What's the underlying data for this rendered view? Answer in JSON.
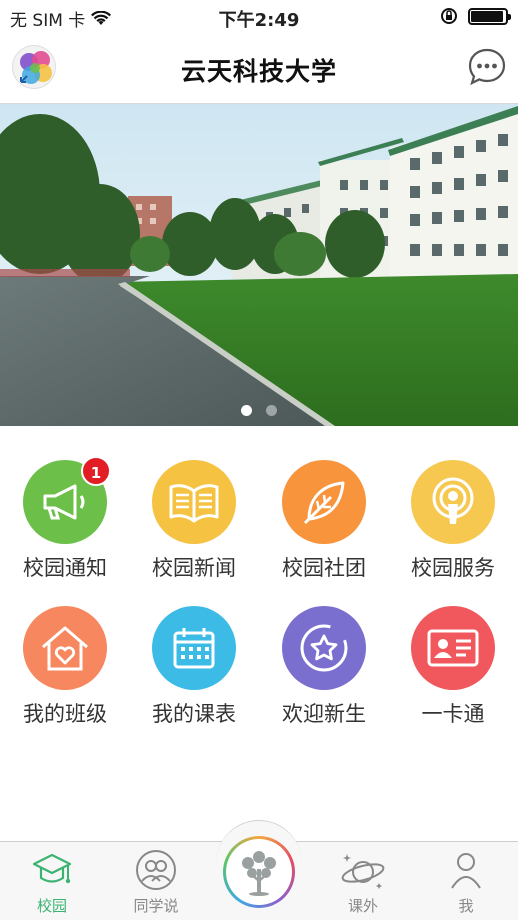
{
  "status_bar": {
    "carrier": "无 SIM 卡",
    "time": "下午2:49",
    "battery_level": 0.95
  },
  "nav": {
    "title": "云天科技大学"
  },
  "banner": {
    "page_count": 2,
    "current_page": 1
  },
  "grid": [
    {
      "label": "校园通知",
      "color": "#6cc04a",
      "icon": "megaphone-icon",
      "badge": "1"
    },
    {
      "label": "校园新闻",
      "color": "#f5c242",
      "icon": "book-icon",
      "badge": ""
    },
    {
      "label": "校园社团",
      "color": "#f7943c",
      "icon": "leaf-icon",
      "badge": ""
    },
    {
      "label": "校园服务",
      "color": "#f6c850",
      "icon": "service-icon",
      "badge": ""
    },
    {
      "label": "我的班级",
      "color": "#f7875e",
      "icon": "house-heart-icon",
      "badge": ""
    },
    {
      "label": "我的课表",
      "color": "#3bbbe6",
      "icon": "calendar-icon",
      "badge": ""
    },
    {
      "label": "欢迎新生",
      "color": "#7a6fcf",
      "icon": "star-icon",
      "badge": ""
    },
    {
      "label": "一卡通",
      "color": "#f0585d",
      "icon": "id-card-icon",
      "badge": ""
    }
  ],
  "tabs": [
    {
      "label": "校园",
      "icon": "graduation-cap-icon",
      "active": true
    },
    {
      "label": "同学说",
      "icon": "people-icon",
      "active": false
    },
    {
      "label": "",
      "icon": "tree-logo-icon",
      "active": false
    },
    {
      "label": "课外",
      "icon": "planet-icon",
      "active": false
    },
    {
      "label": "我",
      "icon": "person-icon",
      "active": false
    }
  ],
  "colors": {
    "accent_green": "#3cb371",
    "badge_red": "#e21d23"
  }
}
